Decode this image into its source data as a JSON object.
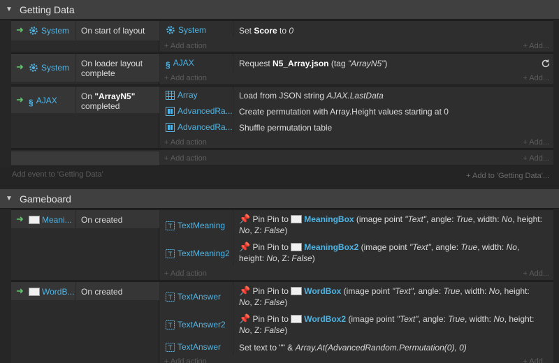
{
  "groups": [
    {
      "title": "Getting Data",
      "add_event": "Add event to 'Getting Data'",
      "add_to": "+ Add to 'Getting Data'..."
    },
    {
      "title": "Gameboard"
    }
  ],
  "events": {
    "e1": {
      "cond_obj": "System",
      "cond_text": "On start of layout",
      "actions": [
        {
          "obj": "System",
          "text_pre": "Set ",
          "text_b": "Score",
          "text_mid": " to ",
          "text_i": "0"
        }
      ]
    },
    "e2": {
      "cond_obj": "System",
      "cond_text": "On loader layout complete",
      "actions": [
        {
          "obj": "AJAX",
          "text_pre": "Request ",
          "text_b": "N5_Array.json",
          "text_mid": " (tag ",
          "text_i": "\"ArrayN5\"",
          "text_post": ")"
        }
      ]
    },
    "e3": {
      "cond_obj": "AJAX",
      "cond_text_pre": "On ",
      "cond_text_b": "\"ArrayN5\"",
      "cond_text_post": "completed",
      "actions": [
        {
          "obj": "Array",
          "text_pre": "Load from JSON string ",
          "text_i": "AJAX.LastData"
        },
        {
          "obj": "AdvancedRa...",
          "text": "Create permutation with Array.Height values starting at 0"
        },
        {
          "obj": "AdvancedRa...",
          "text": "Shuffle permutation table"
        }
      ]
    },
    "e4": {
      "cond_obj": "Meani...",
      "cond_text": "On created",
      "actions": [
        {
          "obj": "TextMeaning",
          "link": "MeaningBox"
        },
        {
          "obj": "TextMeaning2",
          "link": "MeaningBox2"
        }
      ]
    },
    "e5": {
      "cond_obj": "WordB...",
      "cond_text": "On created",
      "actions": [
        {
          "obj": "TextAnswer",
          "link": "WordBox"
        },
        {
          "obj": "TextAnswer2",
          "link": "WordBox2"
        },
        {
          "obj": "TextAnswer",
          "text_pre": "Set text to \"\" & ",
          "text_i": "Array.At(AdvancedRandom.Permutation(0), 0)"
        }
      ]
    }
  },
  "pin": {
    "prefix": "Pin Pin to ",
    "p1": " (image point ",
    "text_q": "\"Text\"",
    "p2": ", angle: ",
    "v_true": "True",
    "p3": ", width: ",
    "v_no": "No",
    "p4": ", height: ",
    "p5": ", Z: ",
    "v_false": "False",
    "p6": ")"
  },
  "labels": {
    "add_action": "+ Add action",
    "add": "+ Add..."
  },
  "icons": {
    "system": "gear-icon",
    "ajax": "ajax-icon",
    "array": "array-icon",
    "advanced_random": "dice-icon",
    "text": "text-icon",
    "sprite": "sprite-thumbnail",
    "pin": "pin-icon",
    "refresh": "refresh-icon"
  },
  "colors": {
    "object_link": "#4fb4e4",
    "condition_arrow": "#5ec46a",
    "pin": "#e0443a"
  }
}
